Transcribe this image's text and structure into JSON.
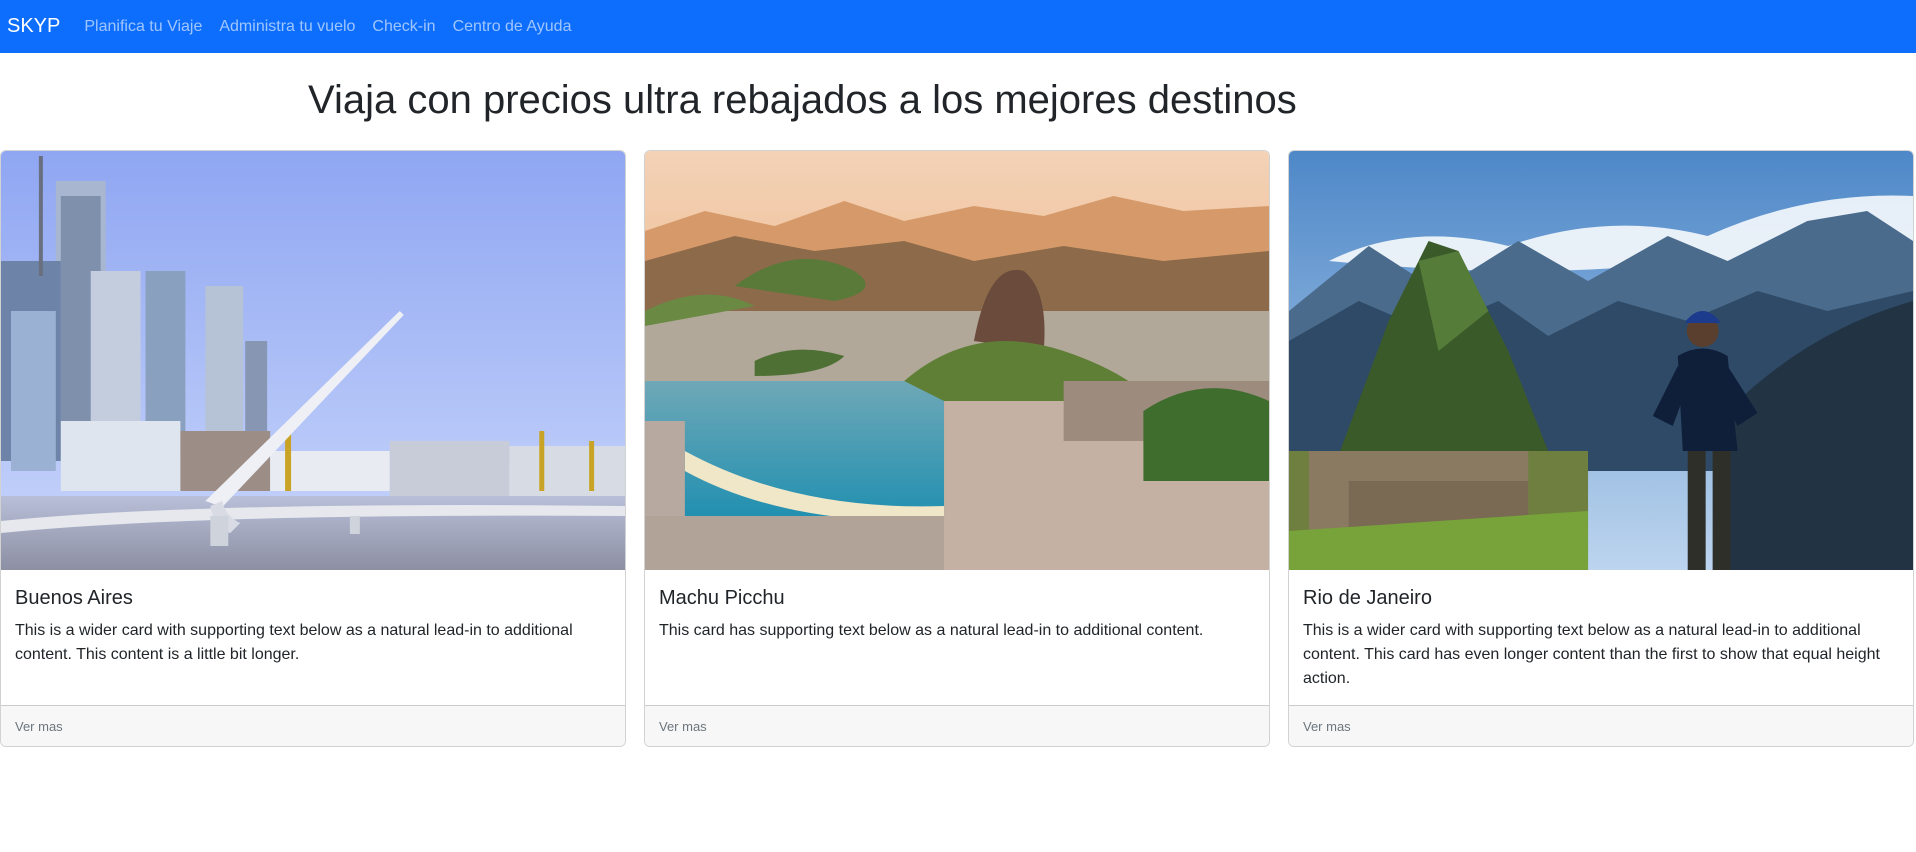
{
  "navbar": {
    "brand": "SKYP",
    "links": [
      "Planifica tu Viaje",
      "Administra tu vuelo",
      "Check-in",
      "Centro de Ayuda"
    ]
  },
  "main": {
    "headline": "Viaja con precios ultra rebajados a los mejores destinos",
    "cards": [
      {
        "title": "Buenos Aires",
        "text": "This is a wider card with supporting text below as a natural lead-in to additional content. This content is a little bit longer.",
        "footer": "Ver mas",
        "image": "buenos-aires-bridge-skyline"
      },
      {
        "title": "Machu Picchu",
        "text": "This card has supporting text below as a natural lead-in to additional content.",
        "footer": "Ver mas",
        "image": "rio-sugarloaf-bay"
      },
      {
        "title": "Rio de Janeiro",
        "text": "This is a wider card with supporting text below as a natural lead-in to additional content. This card has even longer content than the first to show that equal height action.",
        "footer": "Ver mas",
        "image": "machu-picchu-hiker"
      }
    ]
  },
  "colors": {
    "navbar": "#0d6efd",
    "text": "#212529",
    "footer_bg": "#f7f7f7",
    "muted": "#6c757d"
  }
}
